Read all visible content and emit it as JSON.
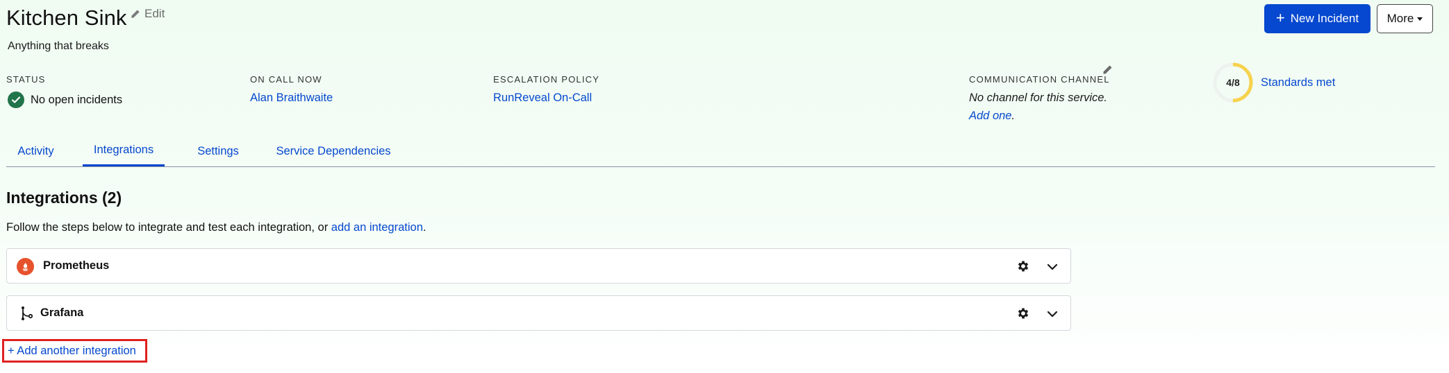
{
  "header": {
    "title": "Kitchen Sink",
    "edit_label": "Edit",
    "subtitle": "Anything that breaks",
    "new_incident_label": "New Incident",
    "more_label": "More"
  },
  "stats": {
    "status": {
      "label": "STATUS",
      "value": "No open incidents"
    },
    "on_call": {
      "label": "ON CALL NOW",
      "value": "Alan Braithwaite"
    },
    "escalation": {
      "label": "ESCALATION POLICY",
      "value": "RunReveal On-Call"
    },
    "communication": {
      "label": "COMMUNICATION CHANNEL",
      "value": "No channel for this service.",
      "add_link": "Add one",
      "add_suffix": "."
    },
    "standards": {
      "score_text": "4/8",
      "met": 4,
      "total": 8,
      "link": "Standards met"
    }
  },
  "tabs": [
    {
      "label": "Activity",
      "active": false
    },
    {
      "label": "Integrations",
      "active": true
    },
    {
      "label": "Settings",
      "active": false
    },
    {
      "label": "Service Dependencies",
      "active": false
    }
  ],
  "integrations": {
    "title": "Integrations (2)",
    "helper_prefix": "Follow the steps below to integrate and test each integration, or ",
    "helper_link": "add an integration",
    "helper_suffix": ".",
    "items": [
      {
        "name": "Prometheus",
        "icon": "prometheus-icon"
      },
      {
        "name": "Grafana",
        "icon": "grafana-icon"
      }
    ],
    "add_another_label": "+ Add another integration"
  },
  "colors": {
    "primary": "#0648cf",
    "success": "#22744a",
    "score_ring": "#f7d24e",
    "highlight": "#e02020",
    "prometheus": "#e6522c"
  }
}
